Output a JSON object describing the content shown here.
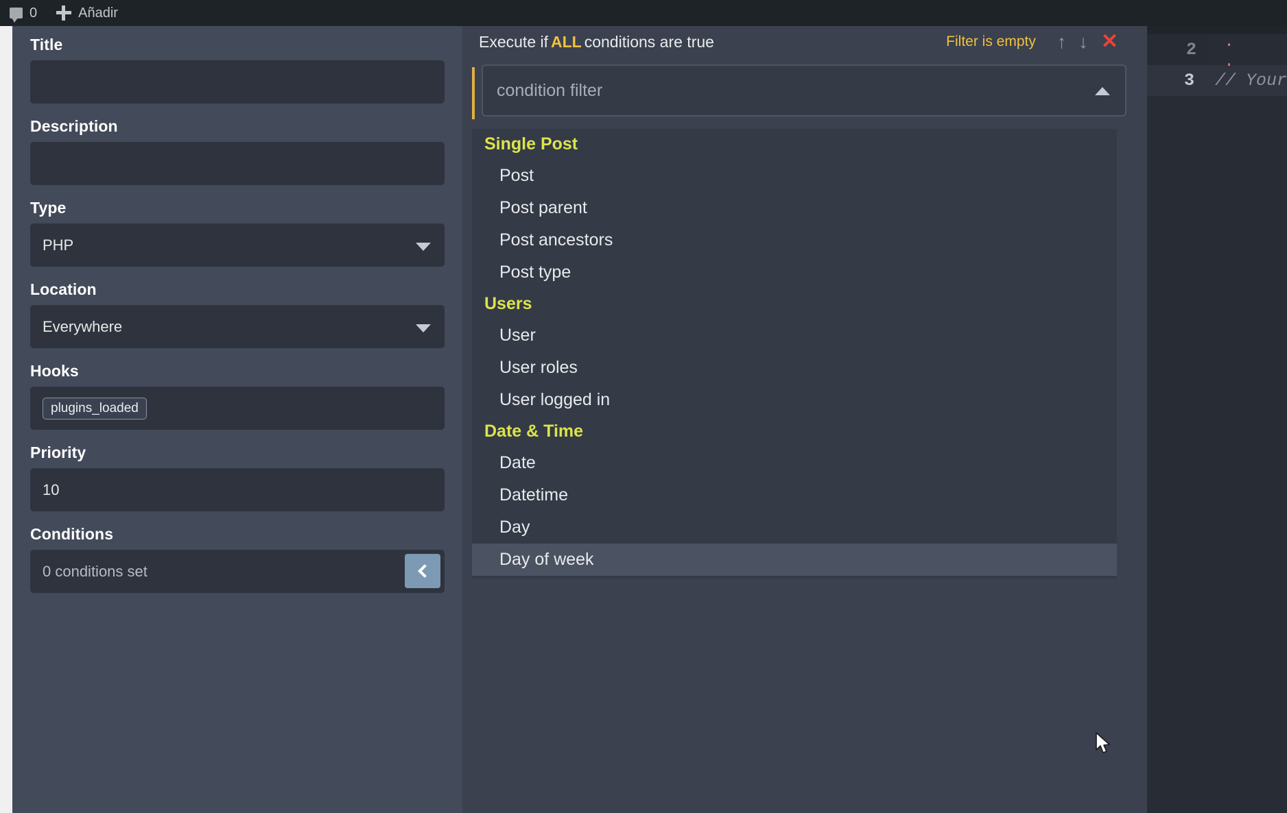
{
  "adminbar": {
    "comment_icon": "comment-bubble-icon",
    "comment_count": "0",
    "add_icon": "plus-icon",
    "add_label": "Añadir"
  },
  "settings": {
    "fields": [
      {
        "label": "Title",
        "value": "",
        "kind": "text"
      },
      {
        "label": "Description",
        "value": "",
        "kind": "text"
      },
      {
        "label": "Type",
        "value": "PHP",
        "kind": "select"
      },
      {
        "label": "Location",
        "value": "Everywhere",
        "kind": "select"
      },
      {
        "label": "Hooks",
        "value": "plugins_loaded",
        "kind": "tags"
      },
      {
        "label": "Priority",
        "value": "10",
        "kind": "number"
      },
      {
        "label": "Conditions",
        "value": "0 conditions set",
        "kind": "conditions"
      }
    ],
    "collapse_icon": "chevron-left-icon"
  },
  "conditions": {
    "header_prefix": "Execute if",
    "header_highlight": "ALL",
    "header_suffix": "conditions are true",
    "filter_status": "Filter is empty",
    "move_up_icon": "arrow-up-icon",
    "move_down_icon": "arrow-down-icon",
    "remove_icon": "close-x-icon",
    "filter_placeholder": "condition filter",
    "filter_value": "",
    "dropdown_toggle_icon": "caret-up-icon",
    "groups": [
      {
        "name": "Single Post",
        "items": [
          "Post",
          "Post parent",
          "Post ancestors",
          "Post type"
        ]
      },
      {
        "name": "Users",
        "items": [
          "User",
          "User roles",
          "User logged in"
        ]
      },
      {
        "name": "Date & Time",
        "items": [
          "Date",
          "Datetime",
          "Day",
          "Day of week"
        ]
      }
    ],
    "selected_item": "Day of week"
  },
  "editor": {
    "lines": [
      {
        "number": "2",
        "text": "",
        "active": false
      },
      {
        "number": "3",
        "text": "// Your",
        "active": true
      }
    ],
    "partial_glyphs": ". ."
  },
  "colors": {
    "accent_yellow": "#f0c040",
    "group_header": "#dbe44a",
    "danger_red": "#e8443a",
    "button_blue": "#7c9ab3",
    "panel_bg": "#434a59",
    "conditions_bg": "#3b414e",
    "editor_bg": "#282c34"
  }
}
